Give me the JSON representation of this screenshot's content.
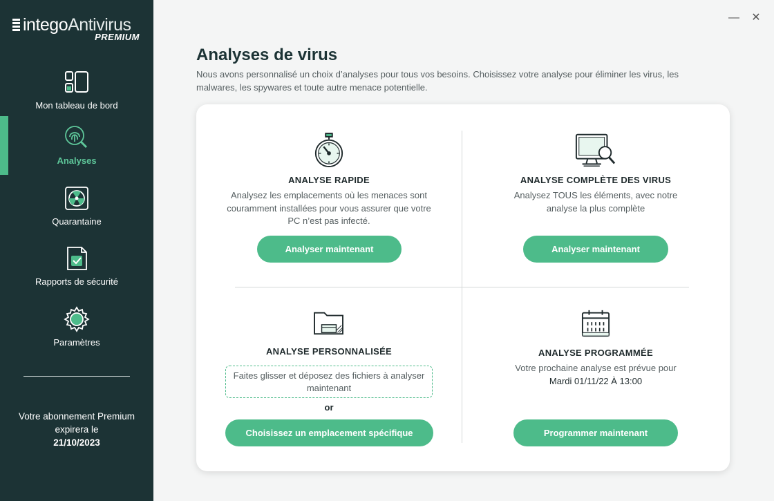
{
  "app": {
    "brand": "intego",
    "product": "Antivirus",
    "edition": "PREMIUM"
  },
  "window": {
    "minimize": "—",
    "close": "✕"
  },
  "sidebar": {
    "items": [
      {
        "label": "Mon tableau de bord",
        "icon": "dashboard-icon"
      },
      {
        "label": "Analyses",
        "icon": "fingerprint-scan-icon",
        "active": true
      },
      {
        "label": "Quarantaine",
        "icon": "radioactive-box-icon"
      },
      {
        "label": "Rapports de sécurité",
        "icon": "security-report-icon"
      },
      {
        "label": "Paramètres",
        "icon": "gear-icon"
      }
    ],
    "subscription": {
      "line1": "Votre abonnement Premium",
      "line2": "expirera le",
      "date": "21/10/2023"
    }
  },
  "main": {
    "title": "Analyses de virus",
    "description": "Nous avons personnalisé un choix d’analyses pour tous vos besoins. Choisissez votre analyse pour éliminer les virus, les malwares, les spywares et toute autre menace potentielle.",
    "scans": {
      "quick": {
        "title": "ANALYSE RAPIDE",
        "description": "Analysez les emplacements où les menaces sont couramment installées pour vous assurer que votre PC n’est pas infecté.",
        "button": "Analyser maintenant",
        "icon": "stopwatch-icon"
      },
      "full": {
        "title": "ANALYSE COMPLÈTE DES VIRUS",
        "description": "Analysez TOUS les éléments, avec notre analyse la plus complète",
        "button": "Analyser maintenant",
        "icon": "monitor-search-icon"
      },
      "custom": {
        "title": "ANALYSE PERSONNALISÉE",
        "dropzone": "Faites glisser et déposez des fichiers à analyser maintenant",
        "or": "or",
        "button": "Choisissez un emplacement spécifique",
        "icon": "folder-icon"
      },
      "scheduled": {
        "title": "ANALYSE PROGRAMMÉE",
        "description": "Votre prochaine analyse est prévue pour",
        "next": "Mardi 01/11/22 À 13:00",
        "button": "Programmer maintenant",
        "icon": "calendar-icon"
      }
    }
  },
  "colors": {
    "sidebar": "#1c3335",
    "accent": "#4dbb8a",
    "active_text": "#5ec79a"
  }
}
